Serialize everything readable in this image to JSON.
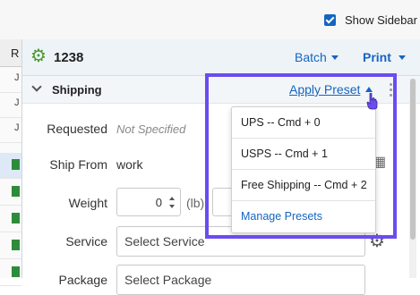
{
  "topbar": {
    "show_sidebar_label": "Show Sidebar",
    "show_sidebar_checked": true
  },
  "grid": {
    "header_label": "R",
    "row_glyph": "J"
  },
  "panel": {
    "order_id": "1238",
    "batch_label": "Batch",
    "print_label": "Print",
    "section_title": "Shipping",
    "apply_preset_label": "Apply Preset",
    "fields": {
      "requested_label": "Requested",
      "requested_value": "Not Specified",
      "ship_from_label": "Ship From",
      "ship_from_value": "work",
      "weight_label": "Weight",
      "weight_value": "0",
      "weight_unit": "(lb)",
      "service_label": "Service",
      "service_placeholder": "Select Service",
      "package_label": "Package",
      "package_placeholder": "Select Package"
    }
  },
  "preset_menu": {
    "items": [
      {
        "label": "UPS -- Cmd + 0"
      },
      {
        "label": "USPS -- Cmd + 1"
      },
      {
        "label": "Free Shipping -- Cmd + 2"
      }
    ],
    "manage_label": "Manage Presets"
  },
  "colors": {
    "accent": "#1565c0",
    "highlight": "#6a4cf0",
    "gear": "#4a9a2e"
  },
  "icons": [
    "gear-icon",
    "chevron-down-icon",
    "kebab-icon",
    "calculator-icon",
    "cursor-hand-icon"
  ]
}
